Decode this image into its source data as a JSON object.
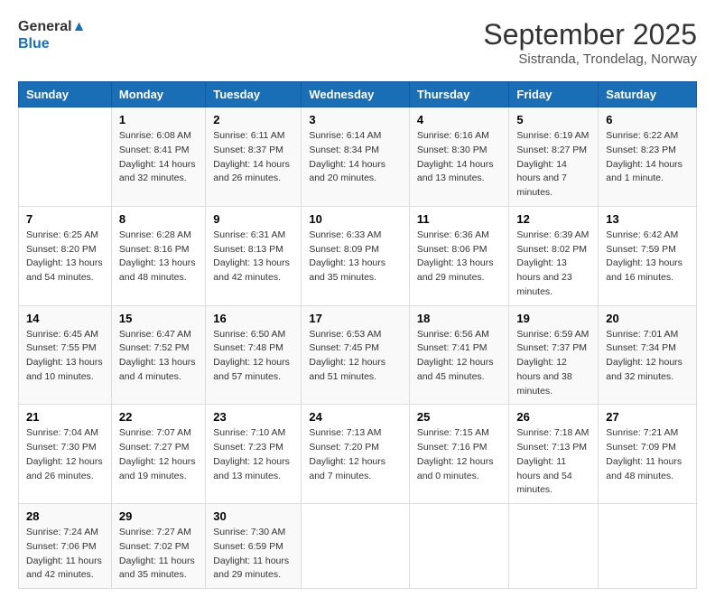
{
  "logo": {
    "general": "General",
    "blue": "Blue"
  },
  "title": "September 2025",
  "subtitle": "Sistranda, Trondelag, Norway",
  "days_header": [
    "Sunday",
    "Monday",
    "Tuesday",
    "Wednesday",
    "Thursday",
    "Friday",
    "Saturday"
  ],
  "weeks": [
    [
      {
        "day": "",
        "sunrise": "",
        "sunset": "",
        "daylight": ""
      },
      {
        "day": "1",
        "sunrise": "Sunrise: 6:08 AM",
        "sunset": "Sunset: 8:41 PM",
        "daylight": "Daylight: 14 hours and 32 minutes."
      },
      {
        "day": "2",
        "sunrise": "Sunrise: 6:11 AM",
        "sunset": "Sunset: 8:37 PM",
        "daylight": "Daylight: 14 hours and 26 minutes."
      },
      {
        "day": "3",
        "sunrise": "Sunrise: 6:14 AM",
        "sunset": "Sunset: 8:34 PM",
        "daylight": "Daylight: 14 hours and 20 minutes."
      },
      {
        "day": "4",
        "sunrise": "Sunrise: 6:16 AM",
        "sunset": "Sunset: 8:30 PM",
        "daylight": "Daylight: 14 hours and 13 minutes."
      },
      {
        "day": "5",
        "sunrise": "Sunrise: 6:19 AM",
        "sunset": "Sunset: 8:27 PM",
        "daylight": "Daylight: 14 hours and 7 minutes."
      },
      {
        "day": "6",
        "sunrise": "Sunrise: 6:22 AM",
        "sunset": "Sunset: 8:23 PM",
        "daylight": "Daylight: 14 hours and 1 minute."
      }
    ],
    [
      {
        "day": "7",
        "sunrise": "Sunrise: 6:25 AM",
        "sunset": "Sunset: 8:20 PM",
        "daylight": "Daylight: 13 hours and 54 minutes."
      },
      {
        "day": "8",
        "sunrise": "Sunrise: 6:28 AM",
        "sunset": "Sunset: 8:16 PM",
        "daylight": "Daylight: 13 hours and 48 minutes."
      },
      {
        "day": "9",
        "sunrise": "Sunrise: 6:31 AM",
        "sunset": "Sunset: 8:13 PM",
        "daylight": "Daylight: 13 hours and 42 minutes."
      },
      {
        "day": "10",
        "sunrise": "Sunrise: 6:33 AM",
        "sunset": "Sunset: 8:09 PM",
        "daylight": "Daylight: 13 hours and 35 minutes."
      },
      {
        "day": "11",
        "sunrise": "Sunrise: 6:36 AM",
        "sunset": "Sunset: 8:06 PM",
        "daylight": "Daylight: 13 hours and 29 minutes."
      },
      {
        "day": "12",
        "sunrise": "Sunrise: 6:39 AM",
        "sunset": "Sunset: 8:02 PM",
        "daylight": "Daylight: 13 hours and 23 minutes."
      },
      {
        "day": "13",
        "sunrise": "Sunrise: 6:42 AM",
        "sunset": "Sunset: 7:59 PM",
        "daylight": "Daylight: 13 hours and 16 minutes."
      }
    ],
    [
      {
        "day": "14",
        "sunrise": "Sunrise: 6:45 AM",
        "sunset": "Sunset: 7:55 PM",
        "daylight": "Daylight: 13 hours and 10 minutes."
      },
      {
        "day": "15",
        "sunrise": "Sunrise: 6:47 AM",
        "sunset": "Sunset: 7:52 PM",
        "daylight": "Daylight: 13 hours and 4 minutes."
      },
      {
        "day": "16",
        "sunrise": "Sunrise: 6:50 AM",
        "sunset": "Sunset: 7:48 PM",
        "daylight": "Daylight: 12 hours and 57 minutes."
      },
      {
        "day": "17",
        "sunrise": "Sunrise: 6:53 AM",
        "sunset": "Sunset: 7:45 PM",
        "daylight": "Daylight: 12 hours and 51 minutes."
      },
      {
        "day": "18",
        "sunrise": "Sunrise: 6:56 AM",
        "sunset": "Sunset: 7:41 PM",
        "daylight": "Daylight: 12 hours and 45 minutes."
      },
      {
        "day": "19",
        "sunrise": "Sunrise: 6:59 AM",
        "sunset": "Sunset: 7:37 PM",
        "daylight": "Daylight: 12 hours and 38 minutes."
      },
      {
        "day": "20",
        "sunrise": "Sunrise: 7:01 AM",
        "sunset": "Sunset: 7:34 PM",
        "daylight": "Daylight: 12 hours and 32 minutes."
      }
    ],
    [
      {
        "day": "21",
        "sunrise": "Sunrise: 7:04 AM",
        "sunset": "Sunset: 7:30 PM",
        "daylight": "Daylight: 12 hours and 26 minutes."
      },
      {
        "day": "22",
        "sunrise": "Sunrise: 7:07 AM",
        "sunset": "Sunset: 7:27 PM",
        "daylight": "Daylight: 12 hours and 19 minutes."
      },
      {
        "day": "23",
        "sunrise": "Sunrise: 7:10 AM",
        "sunset": "Sunset: 7:23 PM",
        "daylight": "Daylight: 12 hours and 13 minutes."
      },
      {
        "day": "24",
        "sunrise": "Sunrise: 7:13 AM",
        "sunset": "Sunset: 7:20 PM",
        "daylight": "Daylight: 12 hours and 7 minutes."
      },
      {
        "day": "25",
        "sunrise": "Sunrise: 7:15 AM",
        "sunset": "Sunset: 7:16 PM",
        "daylight": "Daylight: 12 hours and 0 minutes."
      },
      {
        "day": "26",
        "sunrise": "Sunrise: 7:18 AM",
        "sunset": "Sunset: 7:13 PM",
        "daylight": "Daylight: 11 hours and 54 minutes."
      },
      {
        "day": "27",
        "sunrise": "Sunrise: 7:21 AM",
        "sunset": "Sunset: 7:09 PM",
        "daylight": "Daylight: 11 hours and 48 minutes."
      }
    ],
    [
      {
        "day": "28",
        "sunrise": "Sunrise: 7:24 AM",
        "sunset": "Sunset: 7:06 PM",
        "daylight": "Daylight: 11 hours and 42 minutes."
      },
      {
        "day": "29",
        "sunrise": "Sunrise: 7:27 AM",
        "sunset": "Sunset: 7:02 PM",
        "daylight": "Daylight: 11 hours and 35 minutes."
      },
      {
        "day": "30",
        "sunrise": "Sunrise: 7:30 AM",
        "sunset": "Sunset: 6:59 PM",
        "daylight": "Daylight: 11 hours and 29 minutes."
      },
      {
        "day": "",
        "sunrise": "",
        "sunset": "",
        "daylight": ""
      },
      {
        "day": "",
        "sunrise": "",
        "sunset": "",
        "daylight": ""
      },
      {
        "day": "",
        "sunrise": "",
        "sunset": "",
        "daylight": ""
      },
      {
        "day": "",
        "sunrise": "",
        "sunset": "",
        "daylight": ""
      }
    ]
  ]
}
